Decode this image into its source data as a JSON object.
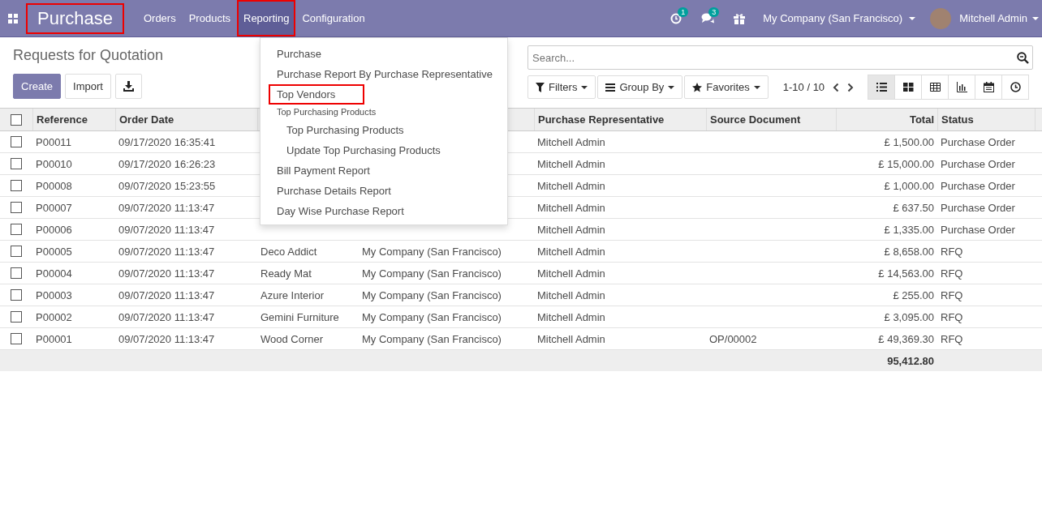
{
  "navbar": {
    "app_title": "Purchase",
    "app_title_highlighted": true,
    "menu": [
      {
        "label": "Orders",
        "selected": false,
        "highlighted": false
      },
      {
        "label": "Products",
        "selected": false,
        "highlighted": false
      },
      {
        "label": "Reporting",
        "selected": true,
        "highlighted": true
      },
      {
        "label": "Configuration",
        "selected": false,
        "highlighted": false
      }
    ],
    "activity_badge": "1",
    "messages_badge": "3",
    "company": "My Company (San Francisco)",
    "user": "Mitchell Admin"
  },
  "reporting_menu": [
    {
      "kind": "item",
      "label": "Purchase",
      "highlighted": false
    },
    {
      "kind": "item",
      "label": "Purchase Report By Purchase Representative",
      "highlighted": false
    },
    {
      "kind": "item",
      "label": "Top Vendors",
      "highlighted": true
    },
    {
      "kind": "header",
      "label": "Top Purchasing Products",
      "highlighted": false
    },
    {
      "kind": "subitem",
      "label": "Top Purchasing Products",
      "highlighted": false
    },
    {
      "kind": "subitem",
      "label": "Update Top Purchasing Products",
      "highlighted": false
    },
    {
      "kind": "item",
      "label": "Bill Payment Report",
      "highlighted": false
    },
    {
      "kind": "item",
      "label": "Purchase Details Report",
      "highlighted": false
    },
    {
      "kind": "item",
      "label": "Day Wise Purchase Report",
      "highlighted": false
    }
  ],
  "page_title": "Requests for Quotation",
  "buttons": [
    "Create",
    "Import"
  ],
  "search": {
    "placeholder": "Search..."
  },
  "filters": [
    "Filters",
    "Group By",
    "Favorites"
  ],
  "pager": "1-10 / 10",
  "views": [
    {
      "kind": "list",
      "selected": true
    },
    {
      "kind": "kanban",
      "selected": false
    },
    {
      "kind": "pivot",
      "selected": false
    },
    {
      "kind": "graph",
      "selected": false
    },
    {
      "kind": "calendar",
      "selected": false
    },
    {
      "kind": "activity",
      "selected": false
    }
  ],
  "table": {
    "columns": [
      "Reference",
      "Order Date",
      null,
      null,
      "Purchase Representative",
      "Source Document",
      "Total",
      "Status"
    ],
    "rows": [
      {
        "checked": false,
        "cells": [
          "P00011",
          "09/17/2020 16:35:41",
          null,
          null,
          "Mitchell Admin",
          null,
          "£ 1,500.00",
          "Purchase Order"
        ]
      },
      {
        "checked": false,
        "cells": [
          "P00010",
          "09/17/2020 16:26:23",
          null,
          null,
          "Mitchell Admin",
          null,
          "£ 15,000.00",
          "Purchase Order"
        ]
      },
      {
        "checked": false,
        "cells": [
          "P00008",
          "09/07/2020 15:23:55",
          null,
          null,
          "Mitchell Admin",
          null,
          "£ 1,000.00",
          "Purchase Order"
        ]
      },
      {
        "checked": false,
        "cells": [
          "P00007",
          "09/07/2020 11:13:47",
          null,
          null,
          "Mitchell Admin",
          null,
          "£ 637.50",
          "Purchase Order"
        ]
      },
      {
        "checked": false,
        "cells": [
          "P00006",
          "09/07/2020 11:13:47",
          null,
          null,
          "Mitchell Admin",
          null,
          "£ 1,335.00",
          "Purchase Order"
        ]
      },
      {
        "checked": false,
        "cells": [
          "P00005",
          "09/07/2020 11:13:47",
          "Deco Addict",
          "My Company (San Francisco)",
          "Mitchell Admin",
          null,
          "£ 8,658.00",
          "RFQ"
        ]
      },
      {
        "checked": false,
        "cells": [
          "P00004",
          "09/07/2020 11:13:47",
          "Ready Mat",
          "My Company (San Francisco)",
          "Mitchell Admin",
          null,
          "£ 14,563.00",
          "RFQ"
        ]
      },
      {
        "checked": false,
        "cells": [
          "P00003",
          "09/07/2020 11:13:47",
          "Azure Interior",
          "My Company (San Francisco)",
          "Mitchell Admin",
          null,
          "£ 255.00",
          "RFQ"
        ]
      },
      {
        "checked": false,
        "cells": [
          "P00002",
          "09/07/2020 11:13:47",
          "Gemini Furniture",
          "My Company (San Francisco)",
          "Mitchell Admin",
          null,
          "£ 3,095.00",
          "RFQ"
        ]
      },
      {
        "checked": false,
        "cells": [
          "P00001",
          "09/07/2020 11:13:47",
          "Wood Corner",
          "My Company (San Francisco)",
          "Mitchell Admin",
          "OP/00002",
          "£ 49,369.30",
          "RFQ"
        ]
      }
    ],
    "total": "95,412.80",
    "all_checked": false
  }
}
